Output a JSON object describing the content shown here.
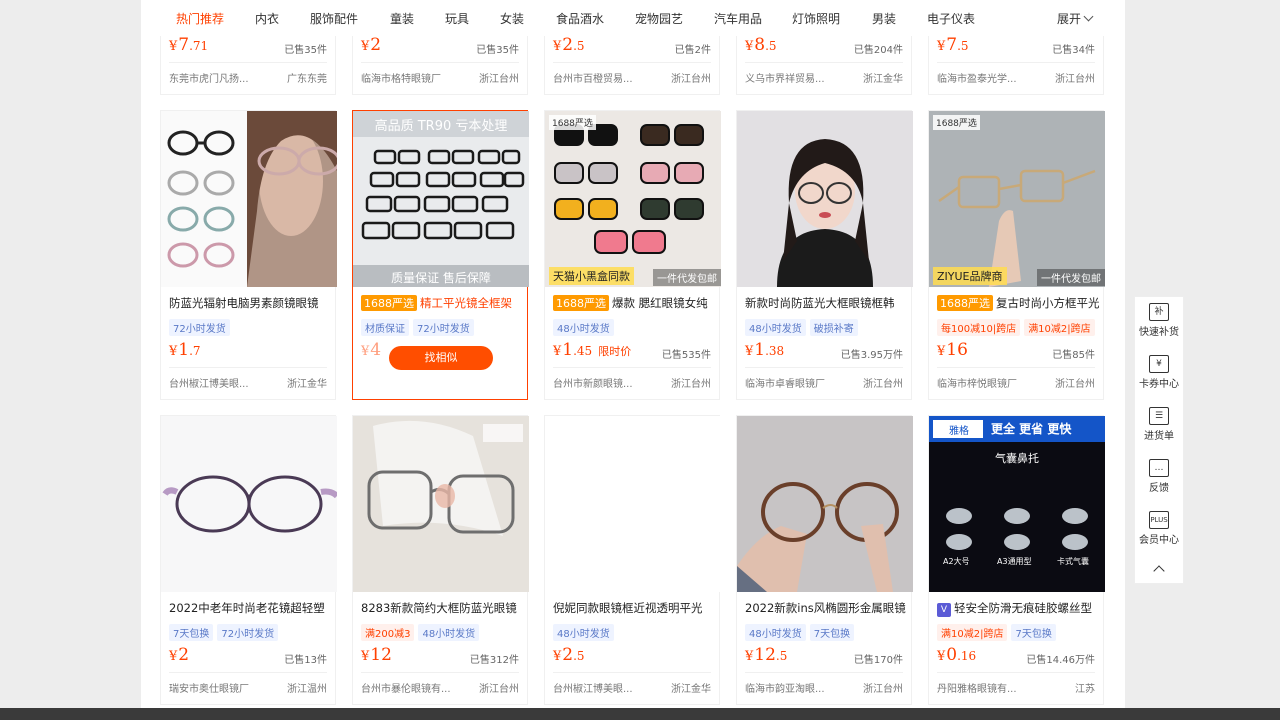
{
  "categories": [
    "热门推荐",
    "内衣",
    "服饰配件",
    "童装",
    "玩具",
    "女装",
    "食品酒水",
    "宠物园艺",
    "汽车用品",
    "灯饰照明",
    "男装",
    "电子仪表"
  ],
  "expand_label": "展开",
  "top_row": [
    {
      "yen": "¥",
      "price_int": "7",
      "price_dec": ".71",
      "sold": "已售35件",
      "seller": "东莞市虎门凡扬...",
      "loc": "广东东莞"
    },
    {
      "yen": "¥",
      "price_int": "2",
      "price_dec": "",
      "sold": "已售35件",
      "seller": "临海市格特眼镜厂",
      "loc": "浙江台州"
    },
    {
      "yen": "¥",
      "price_int": "2",
      "price_dec": ".5",
      "sold": "已售2件",
      "seller": "台州市百橙贸易...",
      "loc": "浙江台州"
    },
    {
      "yen": "¥",
      "price_int": "8",
      "price_dec": ".5",
      "sold": "已售204件",
      "seller": "义乌市界祥贸易...",
      "loc": "浙江金华"
    },
    {
      "yen": "¥",
      "price_int": "7",
      "price_dec": ".5",
      "sold": "已售34件",
      "seller": "临海市盈泰光学...",
      "loc": "浙江台州"
    }
  ],
  "row1": [
    {
      "title": "防蓝光辐射电脑男素颜镜眼镜",
      "tags": [
        {
          "t": "72小时发货",
          "c": "blue"
        }
      ],
      "yen": "¥",
      "price_int": "1",
      "price_dec": ".7",
      "sold": "",
      "seller": "台州椒江博美眼...",
      "loc": "浙江金华"
    },
    {
      "badge": "1688严选",
      "title": "精工平光镜全框架",
      "tags": [
        {
          "t": "材质保证",
          "c": "blue"
        },
        {
          "t": "72小时发货",
          "c": "blue"
        }
      ],
      "yen": "¥",
      "price_int": "4",
      "price_dec": "",
      "sold": "",
      "seller": "",
      "loc": "",
      "img_top": "高品质 TR90 亏本处理",
      "img_bottom": "质量保证   售后保障",
      "btn": "找相似"
    },
    {
      "badge": "1688严选",
      "title": "爆款 腮红眼镜女纯",
      "tags": [
        {
          "t": "48小时发货",
          "c": "blue"
        }
      ],
      "yen": "¥",
      "price_int": "1",
      "price_dec": ".45",
      "promo": "限时价",
      "sold": "已售535件",
      "seller": "台州市新颜眼镜...",
      "loc": "浙江台州",
      "img_bottom": "天猫小黑盒同款",
      "img_corner": "一件代发包邮"
    },
    {
      "title": "新款时尚防蓝光大框眼镜框韩",
      "tags": [
        {
          "t": "48小时发货",
          "c": "blue"
        },
        {
          "t": "破损补寄",
          "c": "blue"
        }
      ],
      "yen": "¥",
      "price_int": "1",
      "price_dec": ".38",
      "sold": "已售3.95万件",
      "seller": "临海市卓睿眼镜厂",
      "loc": "浙江台州"
    },
    {
      "badge": "1688严选",
      "title": "复古时尚小方框平光",
      "tags": [
        {
          "t": "每100减10|跨店",
          "c": "red"
        },
        {
          "t": "满10减2|跨店",
          "c": "red"
        }
      ],
      "yen": "¥",
      "price_int": "16",
      "price_dec": "",
      "sold": "已售85件",
      "seller": "临海市梓悦眼镜厂",
      "loc": "浙江台州",
      "img_topbadge": "1688严选",
      "img_bottom": "ZIYUE品牌商",
      "img_corner": "一件代发包邮"
    }
  ],
  "row2": [
    {
      "title": "2022中老年时尚老花镜超轻塑",
      "tags": [
        {
          "t": "7天包换",
          "c": "blue"
        },
        {
          "t": "72小时发货",
          "c": "blue"
        }
      ],
      "yen": "¥",
      "price_int": "2",
      "price_dec": "",
      "sold": "已售13件",
      "seller": "瑞安市奥仕眼镜厂",
      "loc": "浙江温州"
    },
    {
      "title": "8283新款简约大框防蓝光眼镜",
      "tags": [
        {
          "t": "满200减3",
          "c": "red"
        },
        {
          "t": "48小时发货",
          "c": "blue"
        }
      ],
      "yen": "¥",
      "price_int": "12",
      "price_dec": "",
      "sold": "已售312件",
      "seller": "台州市暴伦眼镜有...",
      "loc": "浙江台州"
    },
    {
      "title": "倪妮同款眼镜框近视透明平光",
      "tags": [
        {
          "t": "48小时发货",
          "c": "blue"
        }
      ],
      "yen": "¥",
      "price_int": "2",
      "price_dec": ".5",
      "sold": "",
      "seller": "台州椒江博美眼...",
      "loc": "浙江金华"
    },
    {
      "title": "2022新款ins风椭圆形金属眼镜",
      "tags": [
        {
          "t": "48小时发货",
          "c": "blue"
        },
        {
          "t": "7天包换",
          "c": "blue"
        }
      ],
      "yen": "¥",
      "price_int": "12",
      "price_dec": ".5",
      "sold": "已售170件",
      "seller": "临海市韵亚淘眼...",
      "loc": "浙江台州"
    },
    {
      "icon": "V",
      "title": "轻安全防滑无痕硅胶螺丝型",
      "tags": [
        {
          "t": "满10减2|跨店",
          "c": "red"
        },
        {
          "t": "7天包换",
          "c": "blue"
        }
      ],
      "yen": "¥",
      "price_int": "0",
      "price_dec": ".16",
      "sold": "已售14.46万件",
      "seller": "丹阳雅格眼镜有...",
      "loc": "江苏",
      "img_header": "更全  更省  更快",
      "img_brand": "雅格",
      "img_sub": "气囊鼻托",
      "img_labels": [
        "A2大号",
        "A3通用型",
        "卡式气囊"
      ]
    }
  ],
  "sidebar": [
    {
      "icon": "补",
      "label": "快速补货",
      "name": "restock-icon"
    },
    {
      "icon": "¥",
      "label": "卡券中心",
      "name": "coupon-icon"
    },
    {
      "icon": "☰",
      "label": "进货单",
      "name": "purchase-list-icon"
    },
    {
      "icon": "…",
      "label": "反馈",
      "name": "feedback-icon"
    },
    {
      "icon": "PLUS",
      "label": "会员中心",
      "name": "member-icon"
    }
  ]
}
